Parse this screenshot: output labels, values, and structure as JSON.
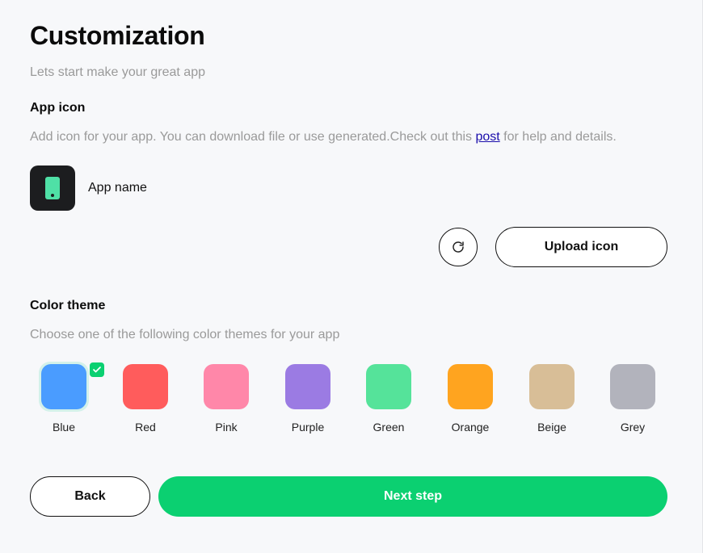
{
  "header": {
    "title": "Customization",
    "subtitle": "Lets start make your great app"
  },
  "app_icon_section": {
    "title": "App icon",
    "description_prefix": "Add icon for your app. You can download file or use generated.Check out this ",
    "link_text": "post",
    "description_suffix": " for help and details.",
    "icon_name": "phone-icon",
    "icon_bg_color": "#1c1d1f",
    "icon_fg_color": "#4fe0a6",
    "app_name": "App name",
    "upload_label": "Upload icon"
  },
  "color_theme_section": {
    "title": "Color theme",
    "description": "Choose one of the following color themes for your app",
    "selected": "Blue",
    "themes": [
      {
        "label": "Blue",
        "color": "#4a9cff"
      },
      {
        "label": "Red",
        "color": "#ff5c5c"
      },
      {
        "label": "Pink",
        "color": "#ff87a9"
      },
      {
        "label": "Purple",
        "color": "#9b7be3"
      },
      {
        "label": "Green",
        "color": "#55e39a"
      },
      {
        "label": "Orange",
        "color": "#ffa41f"
      },
      {
        "label": "Beige",
        "color": "#d8be97"
      },
      {
        "label": "Grey",
        "color": "#b2b3bc"
      }
    ]
  },
  "footer": {
    "back_label": "Back",
    "next_label": "Next step",
    "accent_color": "#0bd071"
  }
}
